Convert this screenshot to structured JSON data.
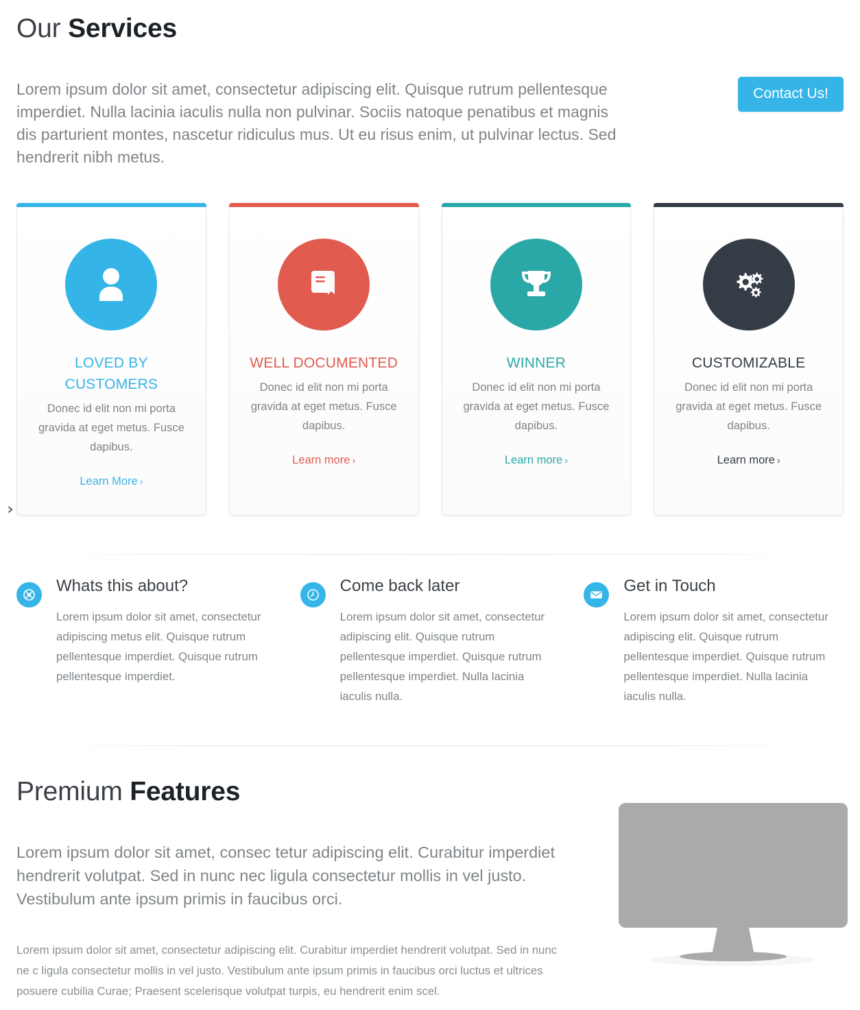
{
  "services": {
    "title_light": "Our ",
    "title_bold": "Services",
    "lead": "Lorem ipsum dolor sit amet, consectetur adipiscing elit. Quisque rutrum pellentesque imperdiet. Nulla lacinia iaculis nulla non pulvinar. Sociis natoque penatibus  et magnis dis parturient montes, nascetur ridiculus mus. Ut eu risus enim, ut pulvinar lectus. Sed hendrerit nibh metus.",
    "contact_button": "Contact Us!",
    "carousel_next": "›"
  },
  "colors": {
    "accent_blue": "#35b4e8",
    "accent_red": "#e15b4f",
    "accent_teal": "#2aa8a8",
    "accent_dark": "#343c46",
    "body_text": "#7f8488",
    "heading": "#2f3640"
  },
  "cards": [
    {
      "icon": "user-icon",
      "color": "#35b4e8",
      "title": "LOVED BY CUSTOMERS",
      "text": "Donec id elit non mi porta gravida at eget metus. Fusce dapibus.",
      "link": "Learn More",
      "chevron": "›"
    },
    {
      "icon": "book-icon",
      "color": "#e15b4f",
      "title": "WELL DOCUMENTED",
      "text": "Donec id elit non mi porta gravida at eget metus. Fusce dapibus.",
      "link": "Learn more",
      "chevron": "›"
    },
    {
      "icon": "trophy-icon",
      "color": "#2aa8a8",
      "title": "WINNER",
      "text": "Donec id elit non mi porta gravida at eget metus. Fusce dapibus.",
      "link": "Learn more",
      "chevron": "›"
    },
    {
      "icon": "gears-icon",
      "color": "#343c46",
      "title": "CUSTOMIZABLE",
      "text": "Donec id elit non mi porta gravida at eget metus. Fusce dapibus.",
      "link": "Learn more",
      "chevron": "›"
    }
  ],
  "info": [
    {
      "icon": "lifebuoy-icon",
      "heading": "Whats this about?",
      "text": "Lorem ipsum dolor sit amet, consectetur adipiscing metus elit. Quisque rutrum pellentesque imperdiet. Quisque rutrum pellentesque imperdiet."
    },
    {
      "icon": "clock-icon",
      "heading": "Come back later",
      "text": "Lorem ipsum dolor sit amet, consectetur adipiscing elit. Quisque rutrum pellentesque imperdiet. Quisque rutrum pellentesque imperdiet. Nulla lacinia iaculis nulla."
    },
    {
      "icon": "envelope-icon",
      "heading": "Get in Touch",
      "text": "Lorem ipsum dolor sit amet, consectetur adipiscing elit. Quisque rutrum pellentesque imperdiet. Quisque rutrum pellentesque imperdiet. Nulla lacinia iaculis nulla."
    }
  ],
  "premium": {
    "title_light": "Premium ",
    "title_bold": "Features",
    "lead": "Lorem ipsum dolor sit amet, consec tetur adipiscing elit. Curabitur imperdiet hendrerit volutpat. Sed in nunc nec ligula consectetur mollis in vel justo. Vestibulum ante ipsum primis in faucibus orci.",
    "body": "Lorem ipsum dolor sit amet, consectetur adipiscing elit. Curabitur imperdiet hendrerit volutpat. Sed in nunc ne c ligula consectetur mollis in vel justo. Vestibulum ante ipsum primis in faucibus orci luctus et ultrices posuere cubilia Curae; Praesent scelerisque volutpat turpis, eu hendrerit enim scel.",
    "image": "desktop-monitor-illustration"
  }
}
